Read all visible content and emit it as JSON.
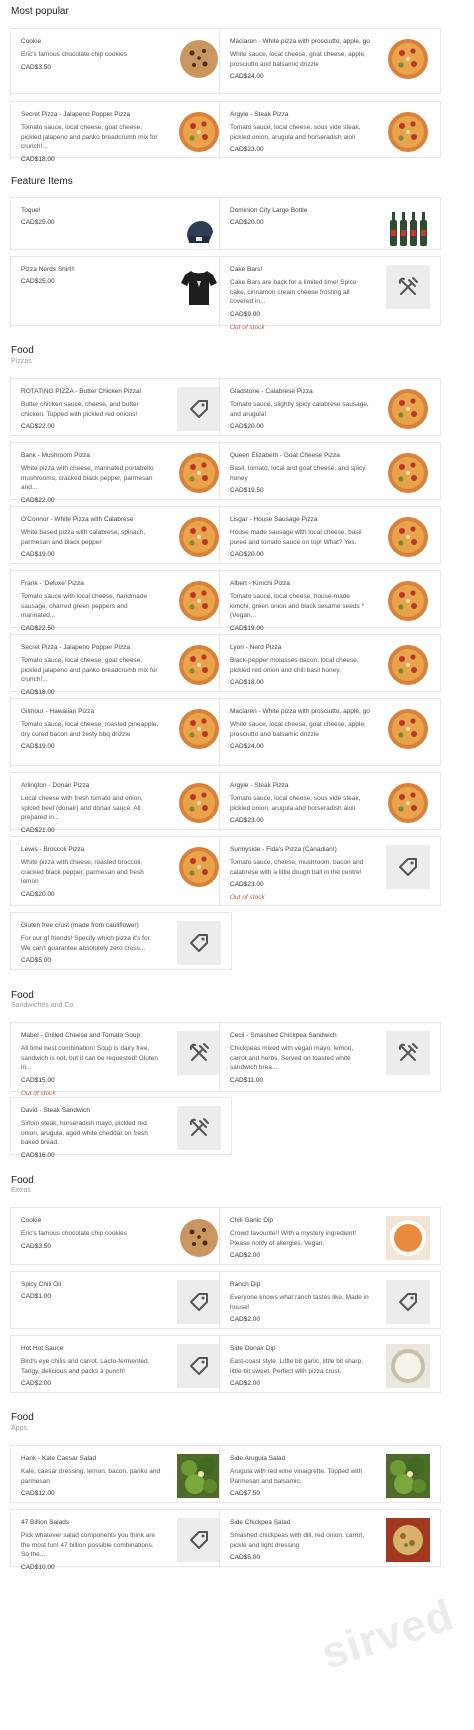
{
  "sections": [
    {
      "title": "Most popular",
      "subtitle": ""
    },
    {
      "title": "Feature Items",
      "subtitle": ""
    },
    {
      "title": "Food",
      "subtitle": "Pizzas"
    },
    {
      "title": "Food",
      "subtitle": "Sandwiches and Co"
    },
    {
      "title": "Food",
      "subtitle": "Extras"
    },
    {
      "title": "Food",
      "subtitle": "Apps"
    }
  ],
  "items": [
    {
      "name": "Cookie",
      "desc": "Eric's famous chocolate chip cookies",
      "price": "CAD$3.50",
      "status": "",
      "image": "cookie"
    },
    {
      "name": "Maclaren - White pizza with prosciutto, apple, goat cheese and spicy honey",
      "desc": "White sauce, local cheese, goat cheese, apple, prosciutto and balsamic drizzle",
      "price": "CAD$24.00",
      "status": "",
      "image": "pizza"
    },
    {
      "name": "Secret Pizza - Jalapeno Popper Pizza",
      "desc": "Tomato sauce, local cheese, goat cheese, pickled jalapeno and panko breadcrumb mix for crunch!...",
      "price": "CAD$18.00",
      "status": "",
      "image": "pizza"
    },
    {
      "name": "Argyle - Steak Pizza",
      "desc": "Tomato sauce, local cheese, sous vide steak, pickled onion, arugula and horseradish aioli",
      "price": "CAD$23.00",
      "status": "",
      "image": "pizza"
    },
    {
      "name": "Toque!",
      "desc": "",
      "price": "CAD$25.00",
      "status": "",
      "image": "toque"
    },
    {
      "name": "Dominion City Large Bottle",
      "desc": "",
      "price": "CAD$20.00",
      "status": "",
      "image": "bottles"
    },
    {
      "name": "Pizza Nerds Shirt!!",
      "desc": "",
      "price": "CAD$25.00",
      "status": "",
      "image": "shirt"
    },
    {
      "name": "Cake Bars!",
      "desc": "Cake Bars are back for a limited time! Spice cake, cinnamon cream cheese frosting all covered in...",
      "price": "CAD$9.00",
      "status": "Out of stock",
      "image": "utensils"
    },
    {
      "name": "ROTATING PIZZA - Butter Chicken Pizza!",
      "desc": "Butter chicken sauce, cheese, and butter chicken. Topped with pickled red onions!",
      "price": "CAD$22.00",
      "status": "",
      "image": "tag"
    },
    {
      "name": "Gladstone - Calabrese Pizza",
      "desc": "Tomato sauce, slightly spicy calabrese sausage, and arugula!",
      "price": "CAD$20.00",
      "status": "",
      "image": "pizza"
    },
    {
      "name": "Bank - Mushroom Pizza",
      "desc": "White pizza with cheese, marinated portabello mushrooms, cracked black pepper, parmesan and...",
      "price": "CAD$22.00",
      "status": "",
      "image": "pizza"
    },
    {
      "name": "Queen Elizabeth - Goat Cheese Pizza",
      "desc": "Basil, tomato, local and goat cheese, and spicy honey",
      "price": "CAD$19.50",
      "status": "",
      "image": "pizza"
    },
    {
      "name": "O'Connor - White Pizza with Calabrese",
      "desc": "White based pizza with calabrese, spinach, parmesan and black pepper",
      "price": "CAD$19.00",
      "status": "",
      "image": "pizza"
    },
    {
      "name": "Lisgar - House Sausage Pizza",
      "desc": "House made sausage with local cheese, basil puree and tomato sauce on top! What? Yes.",
      "price": "CAD$20.00",
      "status": "",
      "image": "pizza"
    },
    {
      "name": "Frank - 'Deluxe' Pizza",
      "desc": "Tomato sauce with local cheese, handmade sausage, charred green peppers and marinated...",
      "price": "CAD$22.50",
      "status": "",
      "image": "pizza"
    },
    {
      "name": "Albert - Kimchi Pizza",
      "desc": "Tomato sauce, local cheese, house-made kimchi, green onion and black sesame seeds *(Vegan...",
      "price": "CAD$19.00",
      "status": "",
      "image": "pizza"
    },
    {
      "name": "Secret Pizza - Jalapeno Popper Pizza",
      "desc": "Tomato sauce, local cheese, goat cheese, pickled jalapeno and panko breadcrumb mix for crunch!...",
      "price": "CAD$18.00",
      "status": "",
      "image": "pizza"
    },
    {
      "name": "Lyon - Nerd Pizza",
      "desc": "Black-pepper molasses bacon, local cheese, pickled red onion and chili basil honey.",
      "price": "CAD$18.00",
      "status": "",
      "image": "pizza"
    },
    {
      "name": "Gilmour - Hawaiian Pizza",
      "desc": "Tomato sauce, local cheese, roasted pineapple, dry cured bacon and zesty bbq drizzle",
      "price": "CAD$19.00",
      "status": "",
      "image": "pizza"
    },
    {
      "name": "Maclaren - White pizza with prosciutto, apple, goat cheese and spicy honey",
      "desc": "White sauce, local cheese, goat cheese, apple, prosciutto and balsamic drizzle",
      "price": "CAD$24.00",
      "status": "",
      "image": "pizza"
    },
    {
      "name": "Arlington - Donair Pizza",
      "desc": "Local cheese with fresh tomato and onion, spiced beef (donair) and donair sauce. All prepared in...",
      "price": "CAD$21.00",
      "status": "",
      "image": "pizza"
    },
    {
      "name": "Argyle - Steak Pizza",
      "desc": "Tomato sauce, local cheese, sous vide steak, pickled onion, arugula and horseradish aioli",
      "price": "CAD$23.00",
      "status": "",
      "image": "pizza"
    },
    {
      "name": "Lewis - Broccoli Pizza",
      "desc": "White pizza with cheese, roasted broccoli, cracked black pepper, parmesan and fresh lemon",
      "price": "CAD$20.00",
      "status": "",
      "image": "pizza"
    },
    {
      "name": "Sunnyside - Fida's Pizza (Canadian!)",
      "desc": "Tomato sauce, cheese, mushroom, bacon and calabrese with a little dough ball in the centre!",
      "price": "CAD$23.00",
      "status": "Out of stock",
      "image": "tag"
    },
    {
      "name": "Gluten free crust (made from cauliflower)",
      "desc": "For our gf friends! Specify which pizza it's for. We can't guarantee absolutely zero cross...",
      "price": "CAD$5.00",
      "status": "",
      "image": "tag"
    },
    {
      "name": "Mabel - Grilled Cheese and Tomato Soup",
      "desc": "All time best combination! Soup is dairy free, sandwich is not, but it can be requested! Gluten in...",
      "price": "CAD$15.00",
      "status": "Out of stock",
      "image": "utensils"
    },
    {
      "name": "Cecil - Smashed Chickpea Sandwich",
      "desc": "Chickpeas mixed with vegan mayo, lemon, carrot and herbs. Served on toasted white sandwich brea...",
      "price": "CAD$11.00",
      "status": "",
      "image": "utensils"
    },
    {
      "name": "David - Steak Sandwich",
      "desc": "Sirloin steak, horseradish mayo, pickled red onion, arugula, aged white cheddar on fresh baked bread.",
      "price": "CAD$16.00",
      "status": "",
      "image": "utensils"
    },
    {
      "name": "Cookie",
      "desc": "Eric's famous chocolate chip cookies",
      "price": "CAD$3.50",
      "status": "",
      "image": "cookie"
    },
    {
      "name": "Chili Garlic Dip",
      "desc": "Crowd favourite!! With a mystery ingredient! Please notify of allergies. Vegan.",
      "price": "CAD$2.00",
      "status": "",
      "image": "dip-orange"
    },
    {
      "name": "Spicy Chili Oil",
      "desc": "",
      "price": "CAD$1.00",
      "status": "",
      "image": "tag"
    },
    {
      "name": "Ranch Dip",
      "desc": "Everyone knows what ranch tastes like. Made in house!",
      "price": "CAD$2.00",
      "status": "",
      "image": "tag"
    },
    {
      "name": "Hot Hot Sauce",
      "desc": "Bird's eye chilis and carrot. Lacto-fermented. Tangy, delicious and packs a punch!",
      "price": "CAD$2.00",
      "status": "",
      "image": "tag"
    },
    {
      "name": "Side Donair Dip",
      "desc": "East-coast style. Little bit garlic, little bit sharp, little bit sweet. Perfect with pizza crust.",
      "price": "CAD$2.00",
      "status": "",
      "image": "dip-white"
    },
    {
      "name": "Hank - Kale Caesar Salad",
      "desc": "Kale, caesar dressing, lemon, bacon, panko and parmesan",
      "price": "CAD$12.00",
      "status": "",
      "image": "salad"
    },
    {
      "name": "Side Arugula Salad",
      "desc": "Arugula with red wine vinaigrette. Topped with Parmesan and balsamic.",
      "price": "CAD$7.50",
      "status": "",
      "image": "salad"
    },
    {
      "name": "47 Billion Salads",
      "desc": "Pick whatever salad components you think are the most fun! 47 billion possible combinations. So the...",
      "price": "CAD$10.00",
      "status": "",
      "image": "tag"
    },
    {
      "name": "Side Chickpea Salad",
      "desc": "Smashed chickpeas with dill, red onion, carrot, pickle and light dressing",
      "price": "CAD$5.00",
      "status": "",
      "image": "chickpea"
    }
  ],
  "watermark": "sirved",
  "colors": {
    "border": "#e6e6e6",
    "out_of_stock": "#b85a3a",
    "placeholder": "#ececec"
  }
}
